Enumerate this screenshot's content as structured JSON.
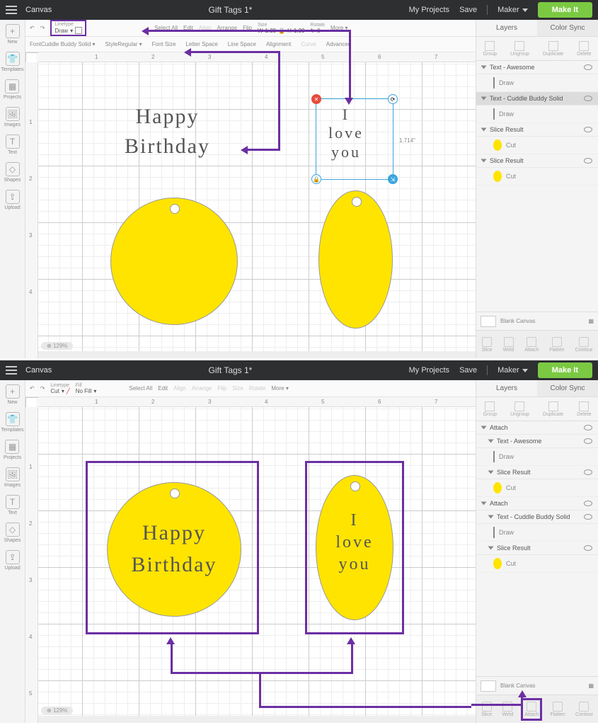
{
  "top": {
    "canvas_label": "Canvas",
    "title": "Gift Tags 1*",
    "myprojects": "My Projects",
    "save": "Save",
    "machine": "Maker",
    "makeit": "Make It"
  },
  "sidebar": {
    "items": [
      {
        "label": "New",
        "icon": "+"
      },
      {
        "label": "Templates",
        "icon": "👕"
      },
      {
        "label": "Projects",
        "icon": "▦"
      },
      {
        "label": "Images",
        "icon": "🖼"
      },
      {
        "label": "Text",
        "icon": "T"
      },
      {
        "label": "Shapes",
        "icon": "◇"
      },
      {
        "label": "Upload",
        "icon": "⇪"
      }
    ]
  },
  "toolbarA": {
    "linetype_lbl": "Linetype",
    "linetype_val": "Draw",
    "selectall": "Select All",
    "edit": "Edit",
    "align": "Align",
    "arrange": "Arrange",
    "flip": "Flip",
    "size": "Size",
    "w": "W",
    "wval": "1.39",
    "h": "H",
    "hval": "1.39",
    "rotate": "Rotate",
    "rval": "0",
    "more": "More"
  },
  "toolbar2A": {
    "font_lbl": "Font",
    "font_val": "Cuddle Buddy Solid",
    "style_lbl": "Style",
    "style_val": "Regular",
    "fontsize_lbl": "Font Size",
    "letterspace_lbl": "Letter Space",
    "linespace_lbl": "Line Space",
    "alignment_lbl": "Alignment",
    "curve_lbl": "Curve",
    "advanced_lbl": "Advanced"
  },
  "toolbarB": {
    "linetype_lbl": "Linetype",
    "linetype_val": "Cut",
    "fill_lbl": "Fill",
    "fill_val": "No Fill",
    "selectall": "Select All",
    "edit": "Edit",
    "align": "Align",
    "arrange": "Arrange",
    "flip": "Flip",
    "size": "Size",
    "rotate": "Rotate",
    "more": "More"
  },
  "canvasA": {
    "hb_line1": "Happy",
    "hb_line2": "Birthday",
    "ily_1": "I",
    "ily_2": "love",
    "ily_3": "you",
    "sel_dim": "1.714\"",
    "zoom": "129%"
  },
  "canvasB": {
    "hb_line1": "Happy",
    "hb_line2": "Birthday",
    "ily_1": "I",
    "ily_2": "love",
    "ily_3": "you",
    "zoom": "129%"
  },
  "panel": {
    "tab_layers": "Layers",
    "tab_colorsync": "Color Sync",
    "group": "Group",
    "ungroup": "Ungroup",
    "duplicate": "Duplicate",
    "delete": "Delete",
    "blank": "Blank Canvas",
    "slice": "Slice",
    "weld": "Weld",
    "attach": "Attach",
    "flatten": "Flatten",
    "contour": "Contour"
  },
  "layersA": [
    {
      "type": "head",
      "label": "Text - Awesome"
    },
    {
      "type": "sub",
      "label": "Draw",
      "icon": "line"
    },
    {
      "type": "head",
      "label": "Text - Cuddle Buddy Solid",
      "sel": true
    },
    {
      "type": "sub",
      "label": "Draw",
      "icon": "line",
      "sel": true
    },
    {
      "type": "head",
      "label": "Slice Result"
    },
    {
      "type": "sub",
      "label": "Cut",
      "icon": "yellow"
    },
    {
      "type": "head",
      "label": "Slice Result"
    },
    {
      "type": "sub",
      "label": "Cut",
      "icon": "yellow"
    }
  ],
  "layersB": [
    {
      "type": "head",
      "label": "Attach"
    },
    {
      "type": "head2",
      "label": "Text - Awesome"
    },
    {
      "type": "sub",
      "label": "Draw",
      "icon": "line"
    },
    {
      "type": "head2",
      "label": "Slice Result"
    },
    {
      "type": "sub",
      "label": "Cut",
      "icon": "yellow"
    },
    {
      "type": "head",
      "label": "Attach"
    },
    {
      "type": "head2",
      "label": "Text - Cuddle Buddy Solid"
    },
    {
      "type": "sub",
      "label": "Draw",
      "icon": "line"
    },
    {
      "type": "head2",
      "label": "Slice Result"
    },
    {
      "type": "sub",
      "label": "Cut",
      "icon": "yellow"
    }
  ],
  "ruler_nums": [
    "1",
    "2",
    "3",
    "4",
    "5",
    "6",
    "7"
  ]
}
